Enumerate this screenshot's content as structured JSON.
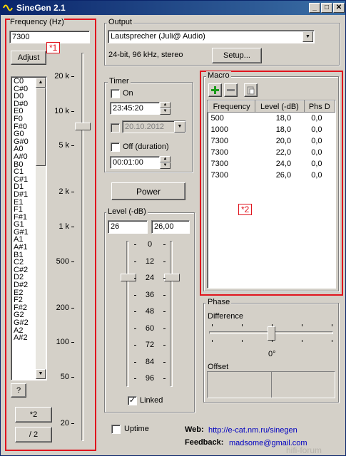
{
  "titlebar": {
    "title": "SineGen 2.1",
    "min": "_",
    "max": "□",
    "close": "✕"
  },
  "frequency": {
    "label": "Frequency (Hz)",
    "value": "7300",
    "adjust_label": "Adjust",
    "notes": [
      "C0",
      "C#0",
      "D0",
      "D#0",
      "E0",
      "F0",
      "F#0",
      "G0",
      "G#0",
      "A0",
      "A#0",
      "B0",
      "C1",
      "C#1",
      "D1",
      "D#1",
      "E1",
      "F1",
      "F#1",
      "G1",
      "G#1",
      "A1",
      "A#1",
      "B1",
      "C2",
      "C#2",
      "D2",
      "D#2",
      "E2",
      "F2",
      "F#2",
      "G2",
      "G#2",
      "A2",
      "A#2"
    ],
    "scale": [
      "20 k",
      "10 k",
      "5 k",
      "2 k",
      "1 k",
      "500",
      "200",
      "100",
      "50",
      "20"
    ],
    "help_label": "?",
    "mul2_label": "*2",
    "div2_label": "/ 2"
  },
  "output": {
    "label": "Output",
    "device": "Lautsprecher (Juli@ Audio)",
    "format": "24-bit, 96 kHz, stereo",
    "setup_label": "Setup..."
  },
  "timer": {
    "label": "Timer",
    "on_label": "On",
    "on_time": "23:45:20",
    "date": "20.10.2012",
    "off_label": "Off (duration)",
    "off_time": "00:01:00"
  },
  "power_label": "Power",
  "level": {
    "label": "Level (-dB)",
    "left_value": "26",
    "right_value": "26,00",
    "scale": [
      "0",
      "12",
      "24",
      "36",
      "48",
      "60",
      "72",
      "84",
      "96"
    ],
    "linked_label": "Linked",
    "linked_check": "✓"
  },
  "macro": {
    "label": "Macro",
    "headers": [
      "Frequency",
      "Level (-dB)",
      "Phs D"
    ],
    "rows": [
      [
        "500",
        "18,0",
        "0,0"
      ],
      [
        "1000",
        "18,0",
        "0,0"
      ],
      [
        "7300",
        "20,0",
        "0,0"
      ],
      [
        "7300",
        "22,0",
        "0,0"
      ],
      [
        "7300",
        "24,0",
        "0,0"
      ],
      [
        "7300",
        "26,0",
        "0,0"
      ]
    ]
  },
  "phase": {
    "label": "Phase",
    "difference_label": "Difference",
    "difference_value": "0°",
    "offset_label": "Offset"
  },
  "uptime_label": "Uptime",
  "footer": {
    "web_label": "Web:",
    "web_url": "http://e-cat.nm.ru/sinegen",
    "feedback_label": "Feedback:",
    "feedback_email": "madsome@gmail.com"
  },
  "annotations": {
    "tag1": "*1",
    "tag2": "*2",
    "watermark": "hifi-forum"
  },
  "colors": {
    "annotation_red": "#e0141e",
    "titlebar_start": "#0a246a",
    "titlebar_end": "#3a6ea5",
    "plus_green": "#1a9a1a",
    "link_blue": "#0000c0"
  },
  "icons": {
    "app": "sine-wave-icon",
    "add": "plus-icon",
    "remove": "minus-icon",
    "copy": "clipboard-icon"
  }
}
